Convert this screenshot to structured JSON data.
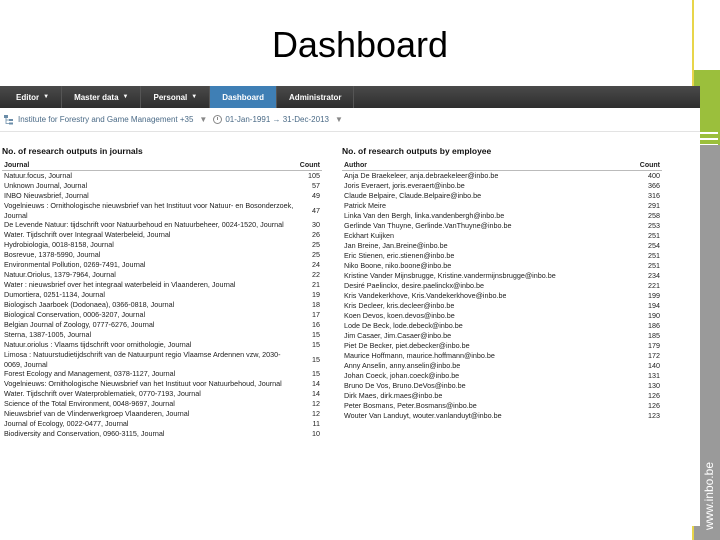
{
  "slide": {
    "title": "Dashboard",
    "brand_url": "www.inbo.be"
  },
  "nav": {
    "tabs": [
      {
        "label": "Editor",
        "caret": true,
        "active": false
      },
      {
        "label": "Master data",
        "caret": true,
        "active": false
      },
      {
        "label": "Personal",
        "caret": true,
        "active": false
      },
      {
        "label": "Dashboard",
        "caret": false,
        "active": true
      },
      {
        "label": "Administrator",
        "caret": false,
        "active": false
      }
    ]
  },
  "filter": {
    "organisation": "Institute for Forestry and Game Management +35",
    "period": "01-Jan-1991 → 31-Dec-2013"
  },
  "journals": {
    "title": "No. of research outputs in journals",
    "col_name": "Journal",
    "col_count": "Count",
    "rows": [
      {
        "name": "Natuur.focus, Journal",
        "count": "105"
      },
      {
        "name": "Unknown Journal, Journal",
        "count": "57"
      },
      {
        "name": "INBO Nieuwsbrief, Journal",
        "count": "49"
      },
      {
        "name": "Vogelnieuws : Ornithologische nieuwsbrief van het Instituut voor Natuur- en Bosonderzoek, Journal",
        "count": "47",
        "tall": true
      },
      {
        "name": "De Levende Natuur: tijdschrift voor Natuurbehoud en Natuurbeheer, 0024-1520, Journal",
        "count": "30"
      },
      {
        "name": "Water. Tijdschrift over Integraal Waterbeleid, Journal",
        "count": "26"
      },
      {
        "name": "Hydrobiologia, 0018-8158, Journal",
        "count": "25"
      },
      {
        "name": "Bosrevue, 1378-5990, Journal",
        "count": "25"
      },
      {
        "name": "Environmental Pollution, 0269-7491, Journal",
        "count": "24"
      },
      {
        "name": "Natuur.Oriolus, 1379-7964, Journal",
        "count": "22"
      },
      {
        "name": "Water : nieuwsbrief over het integraal waterbeleid in Vlaanderen, Journal",
        "count": "21"
      },
      {
        "name": "Dumortiera, 0251-1134, Journal",
        "count": "19"
      },
      {
        "name": "Biologisch Jaarboek (Dodonaea), 0366-0818, Journal",
        "count": "18"
      },
      {
        "name": "Biological Conservation, 0006-3207, Journal",
        "count": "17"
      },
      {
        "name": "Belgian Journal of Zoology, 0777-6276, Journal",
        "count": "16"
      },
      {
        "name": "Sterna, 1387-1005, Journal",
        "count": "15"
      },
      {
        "name": "Natuur.oriolus : Vlaams tijdschrift voor ornithologie, Journal",
        "count": "15"
      },
      {
        "name": "Limosa : Natuurstudietijdschrift van de Natuurpunt regio Vlaamse Ardennen vzw, 2030-0069, Journal",
        "count": "15",
        "tall": true
      },
      {
        "name": "Forest Ecology and Management, 0378-1127, Journal",
        "count": "15"
      },
      {
        "name": "Vogelnieuws: Ornithologische Nieuwsbrief van het Instituut voor Natuurbehoud, Journal",
        "count": "14"
      },
      {
        "name": "Water. Tijdschrift over Waterproblematiek, 0770-7193, Journal",
        "count": "14"
      },
      {
        "name": "Science of the Total Environment, 0048-9697, Journal",
        "count": "12"
      },
      {
        "name": "Nieuwsbrief van de Vlinderwerkgroep Vlaanderen, Journal",
        "count": "12"
      },
      {
        "name": "Journal of Ecology, 0022-0477, Journal",
        "count": "11"
      },
      {
        "name": "Biodiversity and Conservation, 0960-3115, Journal",
        "count": "10"
      }
    ]
  },
  "employees": {
    "title": "No. of research outputs by employee",
    "col_name": "Author",
    "col_count": "Count",
    "rows": [
      {
        "name": "Anja De Braekeleer, anja.debraekeleer@inbo.be",
        "count": "400"
      },
      {
        "name": "Joris Everaert, joris.everaert@inbo.be",
        "count": "366"
      },
      {
        "name": "Claude Belpaire, Claude.Belpaire@inbo.be",
        "count": "316"
      },
      {
        "name": "Patrick Meire",
        "count": "291"
      },
      {
        "name": "Linka Van den Bergh, linka.vandenbergh@inbo.be",
        "count": "258"
      },
      {
        "name": "Gerlinde Van Thuyne, Gerlinde.VanThuyne@inbo.be",
        "count": "253"
      },
      {
        "name": "Eckhart Kuijken",
        "count": "251"
      },
      {
        "name": "Jan Breine, Jan.Breine@inbo.be",
        "count": "254"
      },
      {
        "name": "Eric Stienen, eric.stienen@inbo.be",
        "count": "251"
      },
      {
        "name": "Niko Boone, niko.boone@inbo.be",
        "count": "251"
      },
      {
        "name": "Kristine Vander Mijnsbrugge, Kristine.vandermijnsbrugge@inbo.be",
        "count": "234"
      },
      {
        "name": "Desiré Paelinckx, desire.paelinckx@inbo.be",
        "count": "221"
      },
      {
        "name": "Kris Vandekerkhove, Kris.Vandekerkhove@inbo.be",
        "count": "199"
      },
      {
        "name": "Kris Decleer, kris.decleer@inbo.be",
        "count": "194"
      },
      {
        "name": "Koen Devos, koen.devos@inbo.be",
        "count": "190"
      },
      {
        "name": "Lode De Beck, lode.debeck@inbo.be",
        "count": "186"
      },
      {
        "name": "Jim Casaer, Jim.Casaer@inbo.be",
        "count": "185"
      },
      {
        "name": "Piet De Becker, piet.debecker@inbo.be",
        "count": "179"
      },
      {
        "name": "Maurice Hoffmann, maurice.hoffmann@inbo.be",
        "count": "172"
      },
      {
        "name": "Anny Anselin, anny.anselin@inbo.be",
        "count": "140"
      },
      {
        "name": "Johan Coeck, johan.coeck@inbo.be",
        "count": "131"
      },
      {
        "name": "Bruno De Vos, Bruno.DeVos@inbo.be",
        "count": "130"
      },
      {
        "name": "Dirk Maes, dirk.maes@inbo.be",
        "count": "126"
      },
      {
        "name": "Peter Bosmans, Peter.Bosmans@inbo.be",
        "count": "126"
      },
      {
        "name": "Wouter Van Landuyt, wouter.vanlanduyt@inbo.be",
        "count": "123"
      }
    ]
  }
}
